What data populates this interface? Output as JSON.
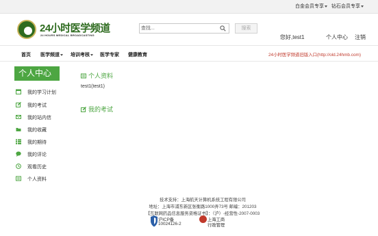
{
  "topbar": {
    "gold_vip": "白金会员专享",
    "diamond_vip": "钻石会员专享"
  },
  "logo": {
    "name_cn": "24小时医学频道",
    "name_en": "24 HOURS MEDICAL BROADCASTING"
  },
  "search": {
    "placeholder": "查找...",
    "button_label": "搜索"
  },
  "user": {
    "greeting": "您好,test1",
    "user_center": "个人中心",
    "logout": "注销"
  },
  "nav": {
    "items": [
      "首页",
      "医学频道",
      "培训考核",
      "医学专家",
      "健康教育"
    ],
    "old_entry": "24小时医学频道旧版入口(http://old.24hmb.com)"
  },
  "sidebar": {
    "title": "个人中心",
    "items": [
      {
        "label": "我的学习计划",
        "icon": "calendar-icon"
      },
      {
        "label": "我的考试",
        "icon": "edit-icon"
      },
      {
        "label": "我的站内信",
        "icon": "envelope-icon"
      },
      {
        "label": "我的收藏",
        "icon": "folder-icon"
      },
      {
        "label": "我的期待",
        "icon": "list-icon"
      },
      {
        "label": "我的评论",
        "icon": "comment-icon"
      },
      {
        "label": "观看历史",
        "icon": "clock-icon"
      },
      {
        "label": "个人资料",
        "icon": "profile-card-icon"
      }
    ]
  },
  "main": {
    "profile_heading": "个人资料",
    "username": "test1(test1)",
    "exam_heading": "我的考试"
  },
  "footer": {
    "tech_support": "技术支持：上海航天计算机系统工程有限公司",
    "address": "地址：上海市浦东新区张衡路1000弄73号 邮编：201203",
    "license": "【互联网药品信息服务资格证书】：（沪）-经营性-2007-0003",
    "icp_label": "沪ICP备",
    "icp_number": "10024126-2",
    "aic_line1": "上海工商",
    "aic_line2": "行政管理"
  },
  "colors": {
    "accent_green": "#4da642",
    "brand_green": "#2e6b1f",
    "link_red": "#c0392b"
  }
}
